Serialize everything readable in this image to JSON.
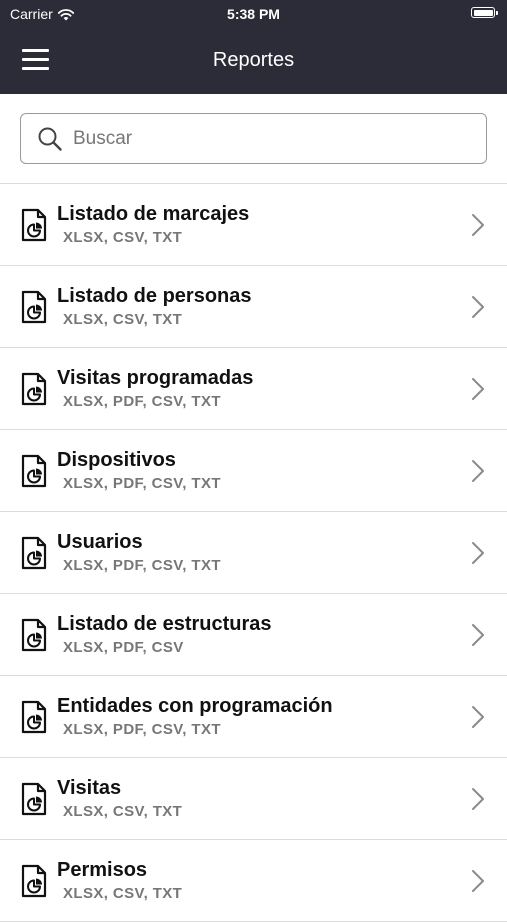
{
  "status_bar": {
    "carrier": "Carrier",
    "time": "5:38 PM"
  },
  "nav": {
    "title": "Reportes",
    "menu_icon": "hamburger-menu-icon"
  },
  "search": {
    "placeholder": "Buscar",
    "value": ""
  },
  "colors": {
    "header_bg": "#2c2c38",
    "divider": "#dcdcdc",
    "subtitle": "#777777"
  },
  "reports": [
    {
      "title": "Listado de marcajes",
      "formats": "XLSX, CSV, TXT"
    },
    {
      "title": "Listado de personas",
      "formats": "XLSX, CSV, TXT"
    },
    {
      "title": "Visitas programadas",
      "formats": "XLSX, PDF, CSV, TXT"
    },
    {
      "title": "Dispositivos",
      "formats": "XLSX, PDF, CSV, TXT"
    },
    {
      "title": "Usuarios",
      "formats": "XLSX, PDF, CSV, TXT"
    },
    {
      "title": "Listado de estructuras",
      "formats": "XLSX, PDF, CSV"
    },
    {
      "title": "Entidades con programación",
      "formats": "XLSX, PDF, CSV, TXT"
    },
    {
      "title": "Visitas",
      "formats": "XLSX, CSV, TXT"
    },
    {
      "title": "Permisos",
      "formats": "XLSX, CSV, TXT"
    }
  ]
}
